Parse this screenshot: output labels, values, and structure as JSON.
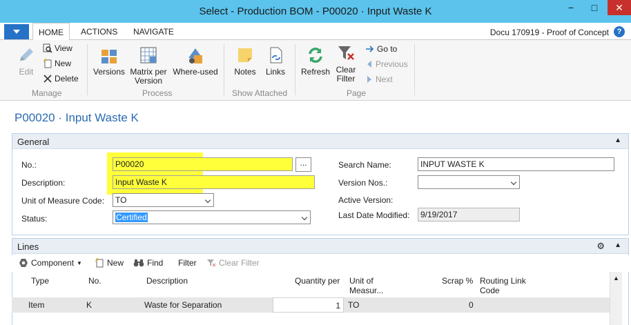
{
  "window": {
    "title": "Select - Production BOM - P00020 · Input Waste K",
    "min_glyph": "−",
    "max_glyph": "□",
    "close_glyph": "✕"
  },
  "tabs": {
    "home": "HOME",
    "actions": "ACTIONS",
    "navigate": "NAVIGATE",
    "company": "Docu 170919 - Proof of Concept",
    "help": "?"
  },
  "ribbon": {
    "edit": "Edit",
    "view": "View",
    "new": "New",
    "delete": "Delete",
    "manage": "Manage",
    "versions": "Versions",
    "matrix": "Matrix per Version",
    "whereused": "Where-used",
    "process": "Process",
    "notes": "Notes",
    "links": "Links",
    "show_attached": "Show Attached",
    "refresh": "Refresh",
    "clear_filter": "Clear Filter",
    "goto": "Go to",
    "previous": "Previous",
    "next": "Next",
    "page_group": "Page"
  },
  "page": {
    "title": "P00020 · Input Waste K"
  },
  "general": {
    "header": "General",
    "no_label": "No.:",
    "no_value": "P00020",
    "desc_label": "Description:",
    "desc_value": "Input Waste K",
    "uom_label": "Unit of Measure Code:",
    "uom_value": "TO",
    "status_label": "Status:",
    "status_value": "Certified",
    "search_label": "Search Name:",
    "search_value": "INPUT WASTE K",
    "version_label": "Version Nos.:",
    "version_value": "",
    "active_label": "Active Version:",
    "modified_label": "Last Date Modified:",
    "modified_value": "9/19/2017"
  },
  "lines": {
    "header": "Lines",
    "component": "Component",
    "new": "New",
    "find": "Find",
    "filter": "Filter",
    "clear_filter": "Clear Filter",
    "columns": {
      "type": "Type",
      "no": "No.",
      "description": "Description",
      "quantity": "Quantity per",
      "uom1": "Unit of",
      "uom2": "Measur...",
      "scrap": "Scrap %",
      "routing1": "Routing Link",
      "routing2": "Code"
    },
    "row": {
      "type": "Item",
      "no": "K",
      "description": "Waste for Separation",
      "quantity": "1",
      "uom": "TO",
      "scrap": "0"
    }
  }
}
